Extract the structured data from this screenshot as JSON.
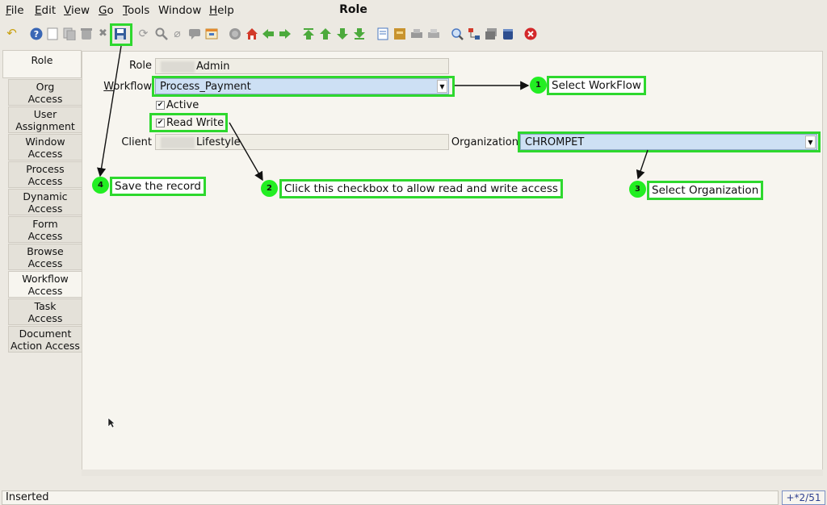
{
  "window": {
    "title": "Role"
  },
  "menu": [
    {
      "key": "F",
      "rest": "ile"
    },
    {
      "key": "E",
      "rest": "dit"
    },
    {
      "key": "V",
      "rest": "iew"
    },
    {
      "key": "G",
      "rest": "o"
    },
    {
      "key": "T",
      "rest": "ools"
    },
    {
      "label": "Window"
    },
    {
      "key": "H",
      "rest": "elp"
    }
  ],
  "tabs": [
    {
      "label1": "Role",
      "label2": ""
    },
    {
      "label1": "Org",
      "label2": "Access"
    },
    {
      "label1": "User",
      "label2": "Assignment"
    },
    {
      "label1": "Window",
      "label2": "Access"
    },
    {
      "label1": "Process",
      "label2": "Access"
    },
    {
      "label1": "Dynamic",
      "label2": "Access"
    },
    {
      "label1": "Form",
      "label2": "Access"
    },
    {
      "label1": "Browse",
      "label2": "Access"
    },
    {
      "label1": "Workflow",
      "label2": "Access"
    },
    {
      "label1": "Task",
      "label2": "Access"
    },
    {
      "label1": "Document",
      "label2": "Action Access"
    }
  ],
  "form": {
    "role_label": "Role",
    "role_value": "Admin",
    "workflow_label_key": "W",
    "workflow_label_rest": "orkflow",
    "workflow_value": "Process_Payment",
    "active_label": "Active",
    "active_checked": "✔",
    "readwrite_label": "Read Write",
    "readwrite_checked": "✔",
    "client_label": "Client",
    "client_value": "Lifestyle",
    "organization_label": "Organization",
    "organization_value": "CHROMPET"
  },
  "annotations": {
    "c1_num": "1",
    "c1_text": "Select WorkFlow",
    "c2_num": "2",
    "c2_text": "Click this checkbox to allow read and write access",
    "c3_num": "3",
    "c3_text": "Select Organization",
    "c4_num": "4",
    "c4_text": "Save the record",
    "accent_color": "#2ed82e"
  },
  "status": {
    "text": "Inserted",
    "record": "+*2/51"
  },
  "toolbar_icons": [
    "undo-icon",
    "help-icon",
    "new-icon",
    "copy-icon",
    "delete-icon",
    "delete-selection-icon",
    "save-icon",
    "refresh-icon",
    "find-icon",
    "attachment-icon",
    "chat-icon",
    "grid-toggle-icon",
    "history-icon",
    "home-icon",
    "back-icon",
    "forward-icon",
    "first-record-icon",
    "previous-record-icon",
    "next-record-icon",
    "last-record-icon",
    "report-icon",
    "archive-icon",
    "print-preview-icon",
    "print-icon",
    "zoom-across-icon",
    "workflow-active-icon",
    "requests-icon",
    "product-info-icon",
    "close-window-icon"
  ]
}
